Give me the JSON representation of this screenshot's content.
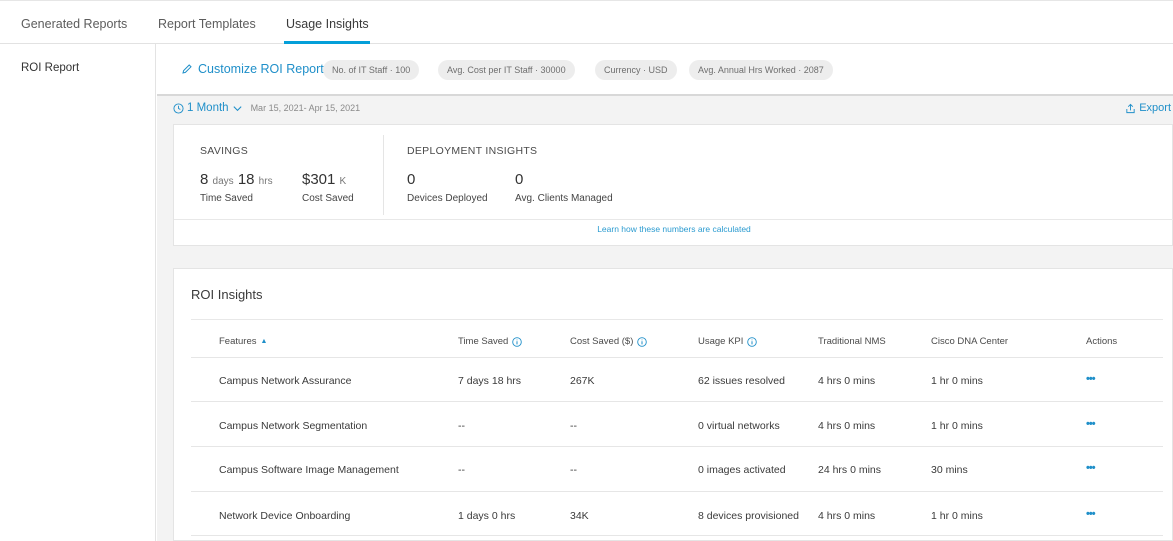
{
  "tabs": [
    {
      "label": "Generated Reports"
    },
    {
      "label": "Report Templates"
    },
    {
      "label": "Usage Insights",
      "active": true
    }
  ],
  "sidebar": {
    "items": [
      {
        "label": "ROI Report"
      }
    ]
  },
  "customize": {
    "button_label": "Customize ROI Report",
    "pills": [
      "No. of IT Staff · 100",
      "Avg. Cost per IT Staff · 30000",
      "Currency · USD",
      "Avg. Annual Hrs Worked · 2087"
    ]
  },
  "range": {
    "label": "1 Month",
    "dates": "Mar 15, 2021- Apr 15, 2021"
  },
  "export_label": "Export",
  "savings": {
    "title": "SAVINGS",
    "time_days": "8",
    "time_days_unit": "days",
    "time_hrs": "18",
    "time_hrs_unit": "hrs",
    "time_caption": "Time Saved",
    "cost_value": "$301",
    "cost_unit": "K",
    "cost_caption": "Cost Saved"
  },
  "deployment": {
    "title": "DEPLOYMENT INSIGHTS",
    "devices_value": "0",
    "devices_caption": "Devices Deployed",
    "clients_value": "0",
    "clients_caption": "Avg. Clients Managed"
  },
  "learn_link": "Learn how these numbers are calculated",
  "roi": {
    "title": "ROI Insights",
    "columns": [
      "Features",
      "Time Saved",
      "Cost Saved ($)",
      "Usage KPI",
      "Traditional NMS",
      "Cisco DNA Center",
      "Actions"
    ],
    "rows": [
      [
        "Campus Network Assurance",
        "7 days 18 hrs",
        "267K",
        "62 issues resolved",
        "4 hrs 0 mins",
        "1 hr 0 mins"
      ],
      [
        "Campus Network Segmentation",
        "--",
        "--",
        "0 virtual networks",
        "4 hrs 0 mins",
        "1 hr 0 mins"
      ],
      [
        "Campus Software Image Management",
        "--",
        "--",
        "0 images activated",
        "24 hrs 0 mins",
        "30 mins"
      ],
      [
        "Network Device Onboarding",
        "1 days 0 hrs",
        "34K",
        "8 devices provisioned",
        "4 hrs 0 mins",
        "1 hr 0 mins"
      ]
    ],
    "actions_glyph": "•••"
  },
  "colors": {
    "accent": "#1f8fc9",
    "tab_underline": "#049fd9"
  },
  "icons": [
    "pencil-icon",
    "clock-icon",
    "chevron-down-icon",
    "export-icon",
    "info-icon",
    "sort-up-icon"
  ]
}
